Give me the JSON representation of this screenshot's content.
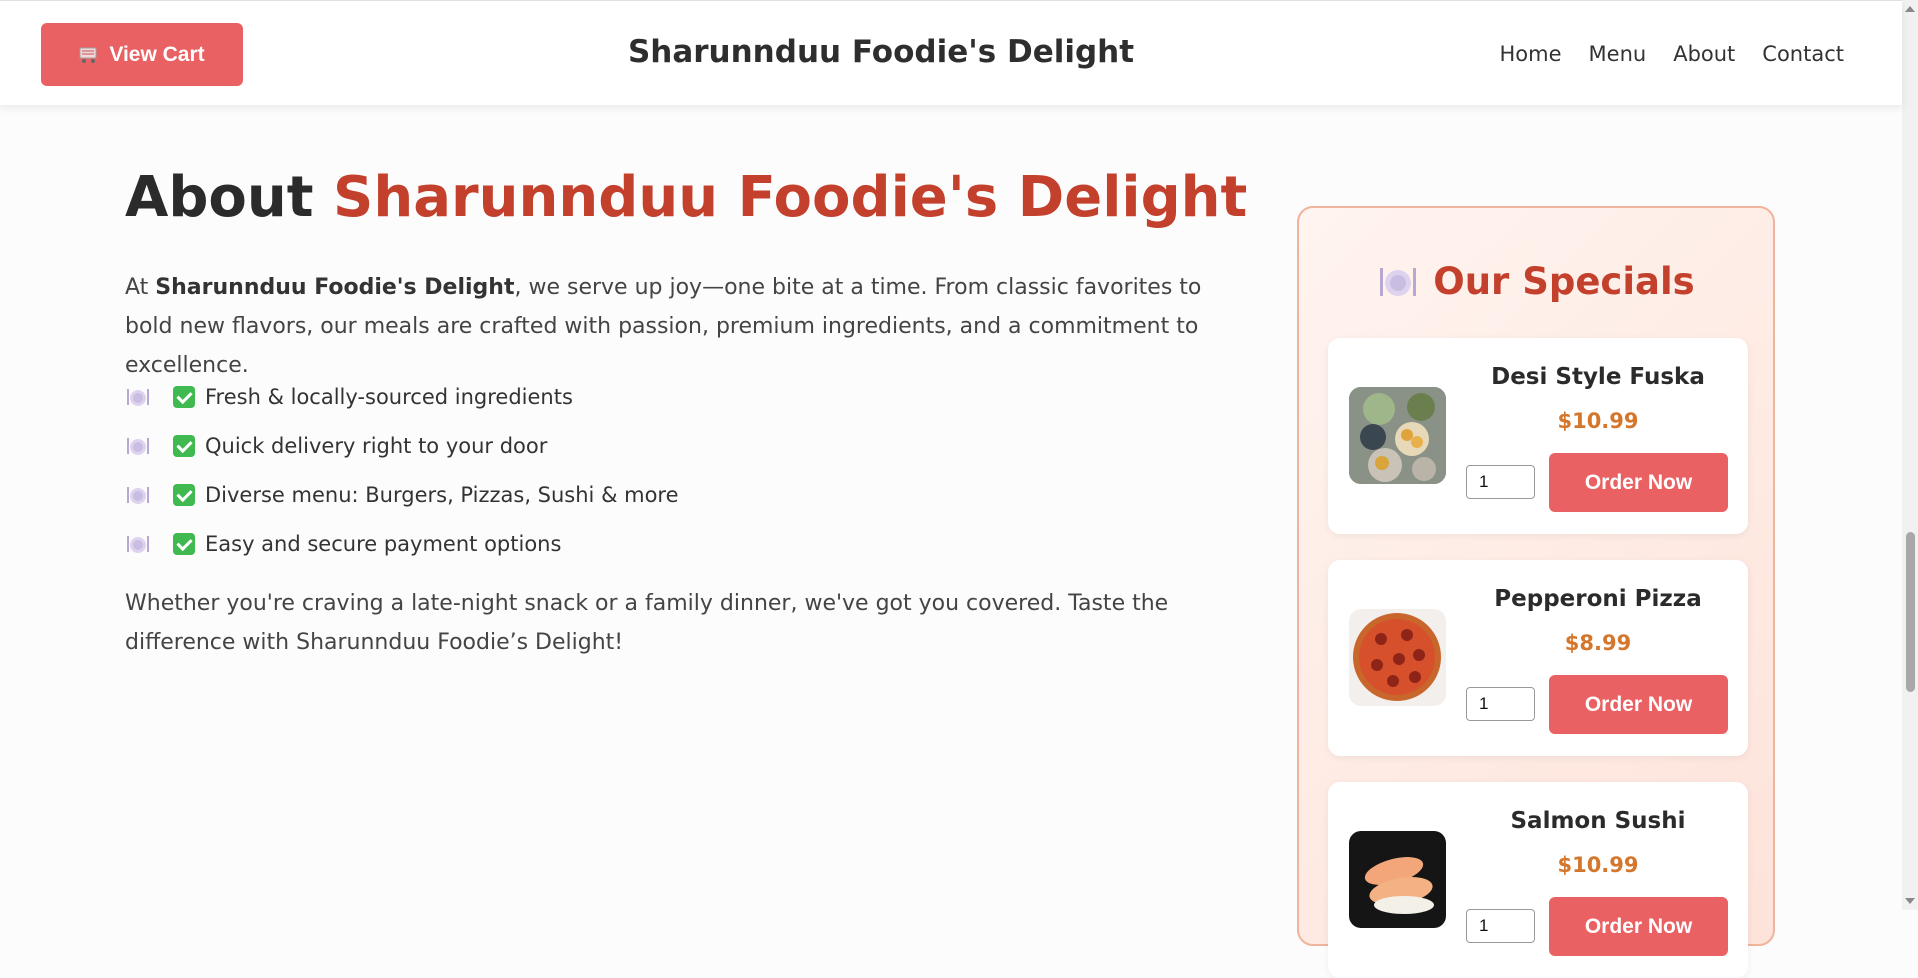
{
  "header": {
    "cart_icon": "cart-icon",
    "cart_label": "View Cart",
    "site_title": "Sharunnduu Foodie's Delight",
    "nav": [
      "Home",
      "Menu",
      "About",
      "Contact"
    ]
  },
  "about": {
    "heading_prefix": "About",
    "heading_accent": "Sharunnduu Foodie's Delight",
    "intro_prefix": "At",
    "intro_bold": "Sharunnduu Foodie's Delight",
    "intro_rest": ", we serve up joy—one bite at a time. From classic favorites to bold new flavors, our meals are crafted with passion, premium ingredients, and a commitment to excellence.",
    "features": [
      "Fresh & locally-sourced ingredients",
      "Quick delivery right to your door",
      "Diverse menu: Burgers, Pizzas, Sushi & more",
      "Easy and secure payment options"
    ],
    "outro": "Whether you're craving a late-night snack or a family dinner, we've got you covered. Taste the difference with Sharunnduu Foodie’s Delight!"
  },
  "specials": {
    "icon": "plate-icon",
    "title": "Our Specials",
    "items": [
      {
        "name": "Desi Style Fuska",
        "price": "$10.99",
        "qty": "1",
        "button": "Order Now",
        "image": "fuska-image"
      },
      {
        "name": "Pepperoni Pizza",
        "price": "$8.99",
        "qty": "1",
        "button": "Order Now",
        "image": "pizza-image"
      },
      {
        "name": "Salmon Sushi",
        "price": "$10.99",
        "qty": "1",
        "button": "Order Now",
        "image": "sushi-image"
      }
    ]
  },
  "colors": {
    "accent": "#c2402c",
    "button": "#e96163",
    "price": "#d4762b"
  }
}
